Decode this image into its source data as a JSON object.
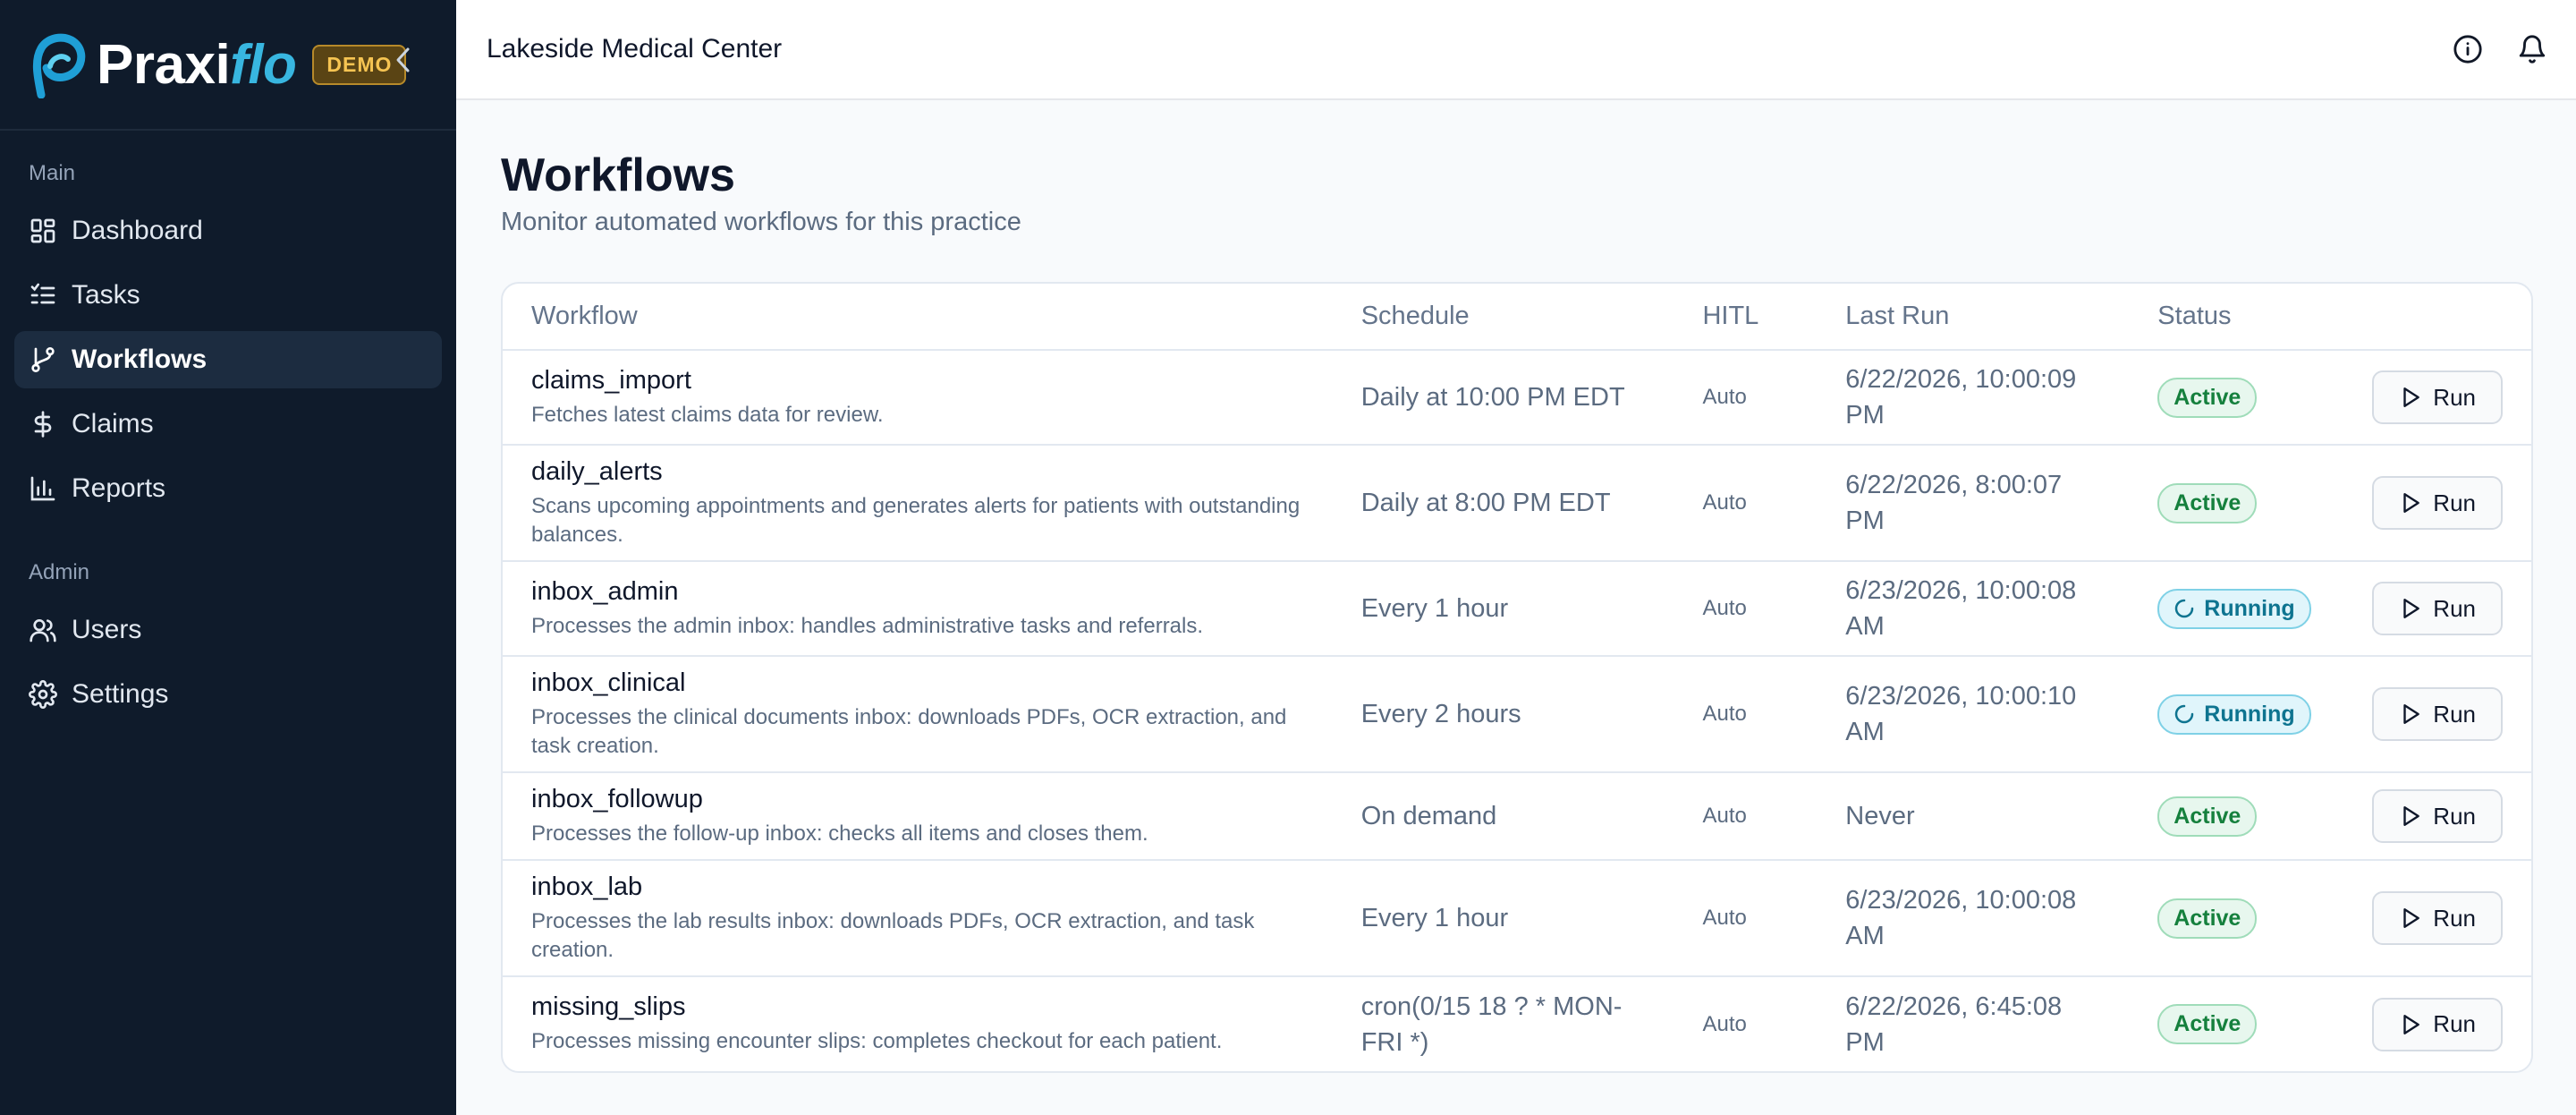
{
  "brand": {
    "name_part1": "Praxi",
    "name_part2": "flo",
    "badge": "DEMO",
    "collapse_icon": "chevron-left-icon"
  },
  "sidebar": {
    "sections": [
      {
        "heading": "Main",
        "items": [
          {
            "label": "Dashboard",
            "icon": "dashboard-icon",
            "active": false
          },
          {
            "label": "Tasks",
            "icon": "list-check-icon",
            "active": false
          },
          {
            "label": "Workflows",
            "icon": "git-branch-icon",
            "active": true
          },
          {
            "label": "Claims",
            "icon": "dollar-icon",
            "active": false
          },
          {
            "label": "Reports",
            "icon": "bar-chart-icon",
            "active": false
          }
        ]
      },
      {
        "heading": "Admin",
        "items": [
          {
            "label": "Users",
            "icon": "users-icon",
            "active": false
          },
          {
            "label": "Settings",
            "icon": "gear-icon",
            "active": false
          }
        ]
      }
    ]
  },
  "topbar": {
    "org_name": "Lakeside Medical Center",
    "icons": [
      "info-icon",
      "bell-icon"
    ]
  },
  "page": {
    "title": "Workflows",
    "subtitle": "Monitor automated workflows for this practice"
  },
  "table": {
    "headers": {
      "workflow": "Workflow",
      "schedule": "Schedule",
      "hitl": "HITL",
      "last_run": "Last Run",
      "status": "Status"
    },
    "run_label": "Run",
    "rows": [
      {
        "name": "claims_import",
        "description": "Fetches latest claims data for review.",
        "schedule": "Daily at 10:00 PM EDT",
        "hitl": "Auto",
        "last_run": "6/22/2026, 10:00:09 PM",
        "status": "Active"
      },
      {
        "name": "daily_alerts",
        "description": "Scans upcoming appointments and generates alerts for patients with outstanding balances.",
        "schedule": "Daily at 8:00 PM EDT",
        "hitl": "Auto",
        "last_run": "6/22/2026, 8:00:07 PM",
        "status": "Active"
      },
      {
        "name": "inbox_admin",
        "description": "Processes the admin inbox: handles administrative tasks and referrals.",
        "schedule": "Every 1 hour",
        "hitl": "Auto",
        "last_run": "6/23/2026, 10:00:08 AM",
        "status": "Running"
      },
      {
        "name": "inbox_clinical",
        "description": "Processes the clinical documents inbox: downloads PDFs, OCR extraction, and task creation.",
        "schedule": "Every 2 hours",
        "hitl": "Auto",
        "last_run": "6/23/2026, 10:00:10 AM",
        "status": "Running"
      },
      {
        "name": "inbox_followup",
        "description": "Processes the follow-up inbox: checks all items and closes them.",
        "schedule": "On demand",
        "hitl": "Auto",
        "last_run": "Never",
        "status": "Active"
      },
      {
        "name": "inbox_lab",
        "description": "Processes the lab results inbox: downloads PDFs, OCR extraction, and task creation.",
        "schedule": "Every 1 hour",
        "hitl": "Auto",
        "last_run": "6/23/2026, 10:00:08 AM",
        "status": "Active"
      },
      {
        "name": "missing_slips",
        "description": "Processes missing encounter slips: completes checkout for each patient.",
        "schedule": "cron(0/15 18 ? * MON-FRI *)",
        "hitl": "Auto",
        "last_run": "6/22/2026, 6:45:08 PM",
        "status": "Active"
      }
    ]
  }
}
